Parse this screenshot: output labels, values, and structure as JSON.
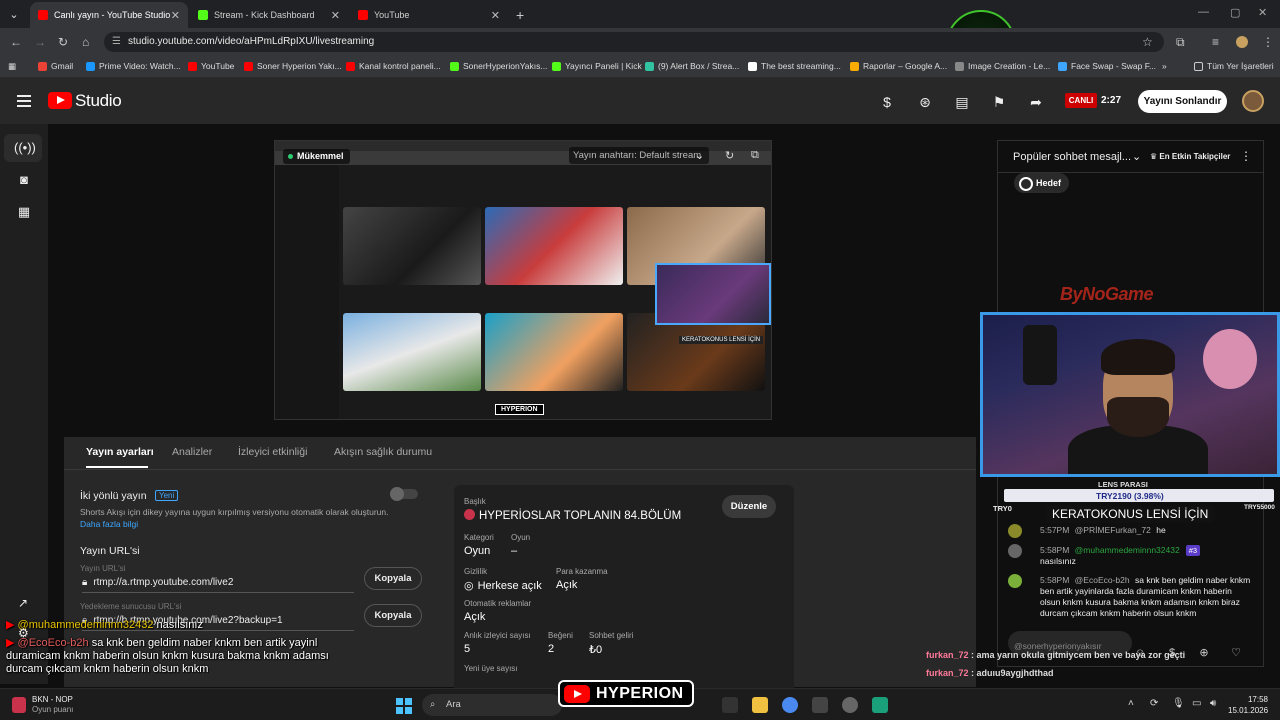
{
  "browser": {
    "tabs": [
      {
        "label": "Canlı yayın - YouTube Studio",
        "color": "#ff0000"
      },
      {
        "label": "Stream - Kick Dashboard",
        "color": "#53fc18"
      },
      {
        "label": "YouTube",
        "color": "#ff0000"
      }
    ],
    "url": "studio.youtube.com/video/aHPmLdRpIXU/livestreaming",
    "bookmarks": [
      {
        "label": "Gmail",
        "color": "#ea4335"
      },
      {
        "label": "Prime Video: Watch...",
        "color": "#1a98ff"
      },
      {
        "label": "YouTube",
        "color": "#ff0000"
      },
      {
        "label": "Soner Hyperion Yakı...",
        "color": "#ff0000"
      },
      {
        "label": "Kanal kontrol paneli...",
        "color": "#ff0000"
      },
      {
        "label": "SonerHyperionYakıs...",
        "color": "#53fc18"
      },
      {
        "label": "Yayıncı Paneli | Kick",
        "color": "#53fc18"
      },
      {
        "label": "(9) Alert Box / Strea...",
        "color": "#31c3a2"
      },
      {
        "label": "The best streaming...",
        "color": "#ffffff"
      },
      {
        "label": "Raporlar – Google A...",
        "color": "#f9ab00"
      },
      {
        "label": "Image Creation - Le...",
        "color": "#888888"
      },
      {
        "label": "Face Swap - Swap F...",
        "color": "#3ea6ff"
      }
    ],
    "all_bookmarks": "Tüm Yer İşaretleri"
  },
  "studio": {
    "logo_text": "Studio",
    "live_badge": "CANLI",
    "live_time": "2:27",
    "end_button": "Yayını Sonlandır"
  },
  "preview": {
    "status": "Mükemmel",
    "stream_key": "Yayın anahtarı: Default stream"
  },
  "tabs": {
    "settings": "Yayın ayarları",
    "analytics": "Analizler",
    "engagement": "İzleyici etkinliği",
    "health": "Akışın sağlık durumu"
  },
  "settings": {
    "dual": {
      "title": "İki yönlü yayın",
      "badge": "Yeni",
      "desc": "Shorts Akışı için dikey yayına uygun kırpılmış versiyonu otomatik olarak oluşturun.",
      "link": "Daha fazla bilgi"
    },
    "url_section": "Yayın URL'si",
    "url_label": "Yayın URL'si",
    "url_value": "rtmp://a.rtmp.youtube.com/live2",
    "backup_label": "Yedekleme sunucusu URL'si",
    "backup_value": "rtmp://b.rtmp.youtube.com/live2?backup=1",
    "copy": "Kopyala"
  },
  "info": {
    "title_label": "Başlık",
    "title": "HYPERİOSLAR TOPLANIN 84.BÖLÜM",
    "edit": "Düzenle",
    "category_label": "Kategori",
    "category": "Oyun",
    "game_label": "Oyun",
    "game": "–",
    "privacy_label": "Gizlilik",
    "privacy": "Herkese açık",
    "monetize_label": "Para kazanma",
    "monetize": "Açık",
    "ads_label": "Otomatik reklamlar",
    "ads": "Açık",
    "viewers_label": "Anlık izleyici sayısı",
    "viewers": "5",
    "likes_label": "Beğeni",
    "likes": "2",
    "revenue_label": "Sohbet geliri",
    "revenue": "₺0",
    "subs_label": "Yeni üye sayısı"
  },
  "chat": {
    "title": "Popüler sohbet mesajl...",
    "sort": "En Etkin Takipçiler",
    "goal": "Hedef",
    "messages": [
      {
        "time": "5:57PM",
        "author": "@PRİMEFurkan_72",
        "text": "he",
        "member": false,
        "avatar": "#8a8a2a"
      },
      {
        "time": "5:58PM",
        "author": "@muhammedeminnn32432",
        "badge": "#3",
        "text": "nasılsınız",
        "member": true,
        "avatar": "#666666"
      },
      {
        "time": "5:58PM",
        "author": "@EcoEco-b2h",
        "text": "sa knk ben geldim naber knkm ben artik yayinlarda fazla duramicam knkm haberin olsun knkm kusura bakma knkm adamsın knkm biraz durcam çıkcam knkm haberin olsun knkm",
        "member": false,
        "avatar": "#7ab03a"
      }
    ],
    "input_placeholder": "@sonerhyperionyakısır"
  },
  "overlay": {
    "brand": "ByNoGame",
    "lens_label": "LENS PARASI",
    "lens_value": "TRY2190 (3.98%)",
    "lens_left": "TRY0",
    "lens_right": "TRY55000",
    "keratokonus": "KERATOKONUS LENSİ İÇİN",
    "hyperion": "HYPERION",
    "left_chat": [
      {
        "user": "@muhammedeminnn32432",
        "text": "nasılsınız"
      },
      {
        "user": "@EcoEco-b2h",
        "text": "sa knk ben geldim naber knkm ben artik yayinl"
      },
      {
        "user": "",
        "text": "duramicam knkm haberin olsun knkm kusura bakma knkm adamsı"
      },
      {
        "user": "",
        "text": "durcam çıkcam knkm haberin olsun knkm"
      }
    ],
    "right_chat": [
      {
        "user": "furkan_72",
        "text": "ama yarın okula gitmiycem ben ve baya zor geçti"
      },
      {
        "user": "furkan_72",
        "text": "aduıu9aygjhdthad"
      }
    ]
  },
  "taskbar": {
    "weather_line1": "BKN - NOP",
    "weather_line2": "Oyun puanı",
    "search": "Ara",
    "time": "17:58",
    "date": "15.01.2026"
  }
}
